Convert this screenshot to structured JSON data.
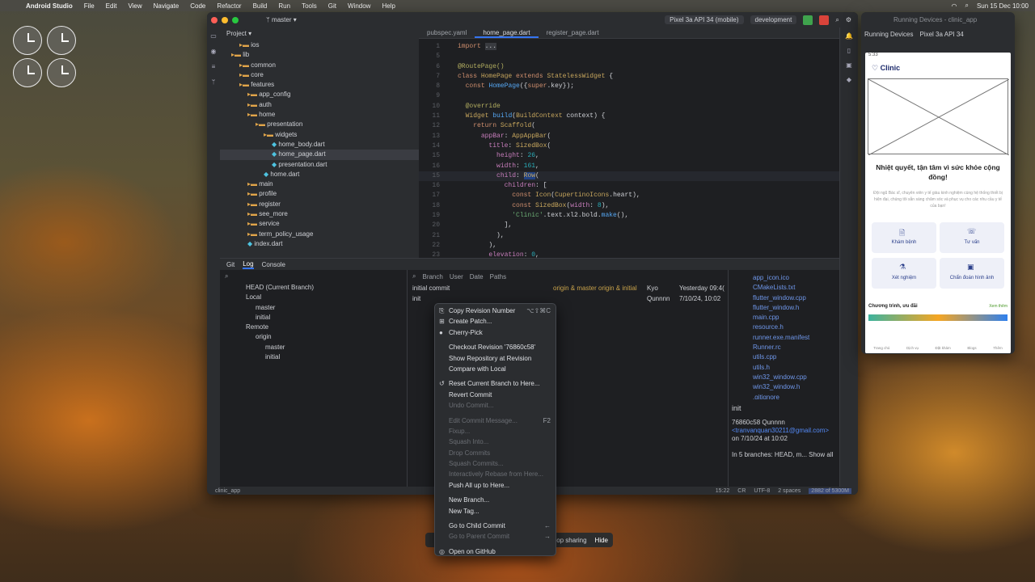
{
  "menubar": {
    "app": "Android Studio",
    "items": [
      "File",
      "Edit",
      "View",
      "Navigate",
      "Code",
      "Refactor",
      "Build",
      "Run",
      "Tools",
      "Git",
      "Window",
      "Help"
    ],
    "datetime": "Sun 15 Dec 10:00"
  },
  "ide": {
    "branch": "master",
    "device_chip": "Pixel 3a API 34 (mobile)",
    "config_chip": "development",
    "project_label": "Project",
    "tree": [
      {
        "t": "ios",
        "k": "folder",
        "d": 2
      },
      {
        "t": "lib",
        "k": "folder",
        "d": 1
      },
      {
        "t": "common",
        "k": "folder",
        "d": 2
      },
      {
        "t": "core",
        "k": "folder",
        "d": 2
      },
      {
        "t": "features",
        "k": "folder",
        "d": 2
      },
      {
        "t": "app_config",
        "k": "folder",
        "d": 3
      },
      {
        "t": "auth",
        "k": "folder",
        "d": 3
      },
      {
        "t": "home",
        "k": "folder",
        "d": 3
      },
      {
        "t": "presentation",
        "k": "folder",
        "d": 4
      },
      {
        "t": "widgets",
        "k": "folder",
        "d": 5
      },
      {
        "t": "home_body.dart",
        "k": "dart",
        "d": 6
      },
      {
        "t": "home_page.dart",
        "k": "dart",
        "d": 6,
        "sel": true
      },
      {
        "t": "presentation.dart",
        "k": "dart",
        "d": 6
      },
      {
        "t": "home.dart",
        "k": "dart",
        "d": 5
      },
      {
        "t": "main",
        "k": "folder",
        "d": 3
      },
      {
        "t": "profile",
        "k": "folder",
        "d": 3
      },
      {
        "t": "register",
        "k": "folder",
        "d": 3
      },
      {
        "t": "see_more",
        "k": "folder",
        "d": 3
      },
      {
        "t": "service",
        "k": "folder",
        "d": 3
      },
      {
        "t": "term_policy_usage",
        "k": "folder",
        "d": 3
      },
      {
        "t": "index.dart",
        "k": "dart",
        "d": 3
      }
    ],
    "tabs": [
      {
        "label": "pubspec.yaml"
      },
      {
        "label": "home_page.dart",
        "active": true
      },
      {
        "label": "register_page.dart"
      }
    ],
    "bottom_tabs": [
      "Git",
      "Log",
      "Console"
    ],
    "branches": [
      {
        "t": "HEAD (Current Branch)",
        "d": 1
      },
      {
        "t": "Local",
        "d": 1
      },
      {
        "t": "master",
        "d": 2
      },
      {
        "t": "initial",
        "d": 2
      },
      {
        "t": "Remote",
        "d": 1
      },
      {
        "t": "origin",
        "d": 2
      },
      {
        "t": "master",
        "d": 3
      },
      {
        "t": "initial",
        "d": 3
      }
    ],
    "filters": [
      "Branch",
      "User",
      "Date",
      "Paths"
    ],
    "commits": [
      {
        "msg": "initial commit",
        "tags": "origin & master   origin & initial",
        "author": "Kyo",
        "date": "Yesterday 09:4("
      },
      {
        "msg": "init",
        "tags": "",
        "author": "Qunnnn",
        "date": "7/10/24, 10:02"
      }
    ],
    "changed_files": [
      "app_icon.ico",
      "CMakeLists.txt",
      "flutter_window.cpp",
      "flutter_window.h",
      "main.cpp",
      "resource.h",
      "runner.exe.manifest",
      "Runner.rc",
      "utils.cpp",
      "utils.h",
      "win32_window.cpp",
      "win32_window.h",
      ".gitignore",
      "CMakeLists.txt"
    ],
    "detail": {
      "title": "init",
      "hash_author": "76860c58 Qunnnn",
      "email": "<tranvanquan30211@gmail.com>",
      "date": "on 7/10/24 at 10:02",
      "branches": "In 5 branches: HEAD, m... Show all"
    },
    "status": {
      "project": "clinic_app",
      "position": "15:22",
      "eol": "CR",
      "encoding": "UTF-8",
      "indent": "2 spaces",
      "memory": "2882 of 5300M"
    }
  },
  "context_menu": [
    {
      "label": "Copy Revision Number",
      "shortcut": "⌥⇧⌘C",
      "icon": "copy"
    },
    {
      "label": "Create Patch...",
      "icon": "patch"
    },
    {
      "label": "Cherry-Pick",
      "icon": "cherry"
    },
    {
      "sep": true
    },
    {
      "label": "Checkout Revision '76860c58'"
    },
    {
      "label": "Show Repository at Revision"
    },
    {
      "label": "Compare with Local"
    },
    {
      "sep": true
    },
    {
      "label": "Reset Current Branch to Here...",
      "icon": "reset"
    },
    {
      "label": "Revert Commit"
    },
    {
      "label": "Undo Commit...",
      "disabled": true
    },
    {
      "sep": true
    },
    {
      "label": "Edit Commit Message...",
      "shortcut": "F2",
      "disabled": true
    },
    {
      "label": "Fixup...",
      "disabled": true
    },
    {
      "label": "Squash Into...",
      "disabled": true
    },
    {
      "label": "Drop Commits",
      "disabled": true
    },
    {
      "label": "Squash Commits...",
      "disabled": true
    },
    {
      "label": "Interactively Rebase from Here...",
      "disabled": true
    },
    {
      "label": "Push All up to Here..."
    },
    {
      "sep": true
    },
    {
      "label": "New Branch..."
    },
    {
      "label": "New Tag..."
    },
    {
      "sep": true
    },
    {
      "label": "Go to Child Commit",
      "shortcut": "←"
    },
    {
      "label": "Go to Parent Commit",
      "shortcut": "→",
      "disabled": true
    },
    {
      "sep": true
    },
    {
      "label": "Open on GitHub",
      "icon": "github"
    }
  ],
  "share_bar": {
    "text": "op sharing",
    "hide": "Hide"
  },
  "devices": {
    "header": "Running Devices - clinic_app",
    "tabs": [
      "Running Devices",
      "Pixel 3a API 34"
    ],
    "phone": {
      "time": "5:33",
      "app_title": "Clinic",
      "headline": "Nhiệt quyết, tận tâm vì sức khỏe cộng đồng!",
      "body": "Đội ngũ Bác sĩ, chuyên viên y tế giàu kinh nghiệm cùng hệ thống thiết bị hiện đại, chúng tôi sẵn sàng chăm sóc và phục vụ cho các nhu cầu y tế của bạn!",
      "cards": [
        "Khám bệnh",
        "Tư vấn",
        "Xét nghiệm",
        "Chẩn đoán hình ảnh"
      ],
      "promo": "Chương trình, ưu đãi",
      "see_all": "Xem thêm",
      "nav": [
        "Trang chủ",
        "Dịch vụ",
        "Đặt khám",
        "Blogs",
        "Thêm"
      ]
    }
  },
  "colors": {
    "accent": "#3574f0",
    "menu_bg": "#2b2d30",
    "folder": "#e1a54a",
    "dart": "#4ec3e0"
  }
}
